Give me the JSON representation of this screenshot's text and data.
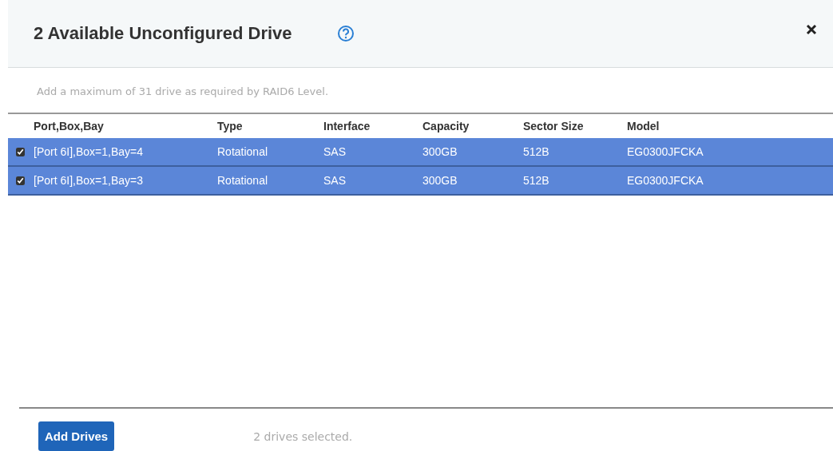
{
  "dialog": {
    "title": "2 Available Unconfigured Drive",
    "hint": "Add a maximum of 31 drive as required by RAID6 Level."
  },
  "table": {
    "columns": [
      "Port,Box,Bay",
      "Type",
      "Interface",
      "Capacity",
      "Sector Size",
      "Model"
    ],
    "rows": [
      {
        "checked": true,
        "selected": true,
        "cells": [
          "[Port 6I],Box=1,Bay=4",
          "Rotational",
          "SAS",
          "300GB",
          "512B",
          "EG0300JFCKA"
        ]
      },
      {
        "checked": true,
        "selected": true,
        "cells": [
          "[Port 6I],Box=1,Bay=3",
          "Rotational",
          "SAS",
          "300GB",
          "512B",
          "EG0300JFCKA"
        ]
      }
    ]
  },
  "footer": {
    "button": "Add Drives",
    "status": "2 drives selected."
  }
}
